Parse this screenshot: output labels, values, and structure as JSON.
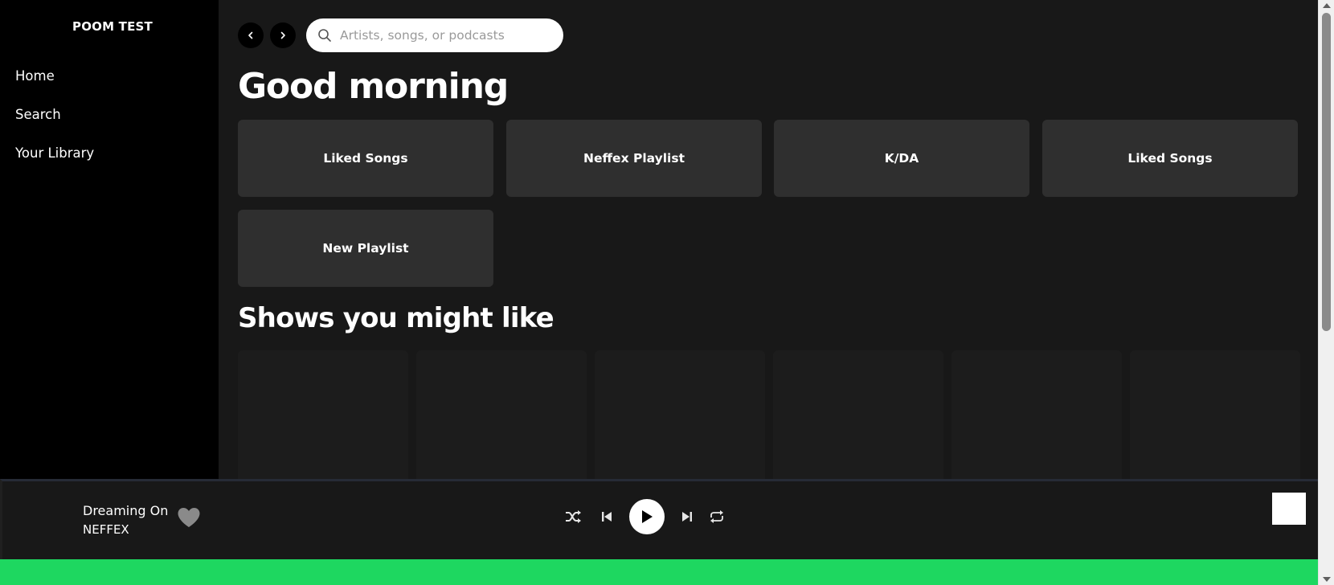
{
  "sidebar": {
    "brand": "POOM TEST",
    "items": [
      {
        "label": "Home"
      },
      {
        "label": "Search"
      },
      {
        "label": "Your Library"
      }
    ]
  },
  "header": {
    "search_placeholder": "Artists, songs, or podcasts",
    "back_icon": "chevron-left-icon",
    "forward_icon": "chevron-right-icon"
  },
  "main": {
    "greeting": "Good morning",
    "playlists": [
      {
        "label": "Liked Songs"
      },
      {
        "label": "Neffex Playlist"
      },
      {
        "label": "K/DA"
      },
      {
        "label": "Liked Songs"
      },
      {
        "label": "New Playlist"
      }
    ],
    "shows_title": "Shows you might like"
  },
  "player": {
    "track_title": "Dreaming On",
    "track_artist": "NEFFEX",
    "progress_fraction": 1.0
  },
  "colors": {
    "accent": "#1ed760",
    "sidebar_bg": "#000000",
    "main_bg": "#181818",
    "card_bg": "#2f2f2f"
  }
}
